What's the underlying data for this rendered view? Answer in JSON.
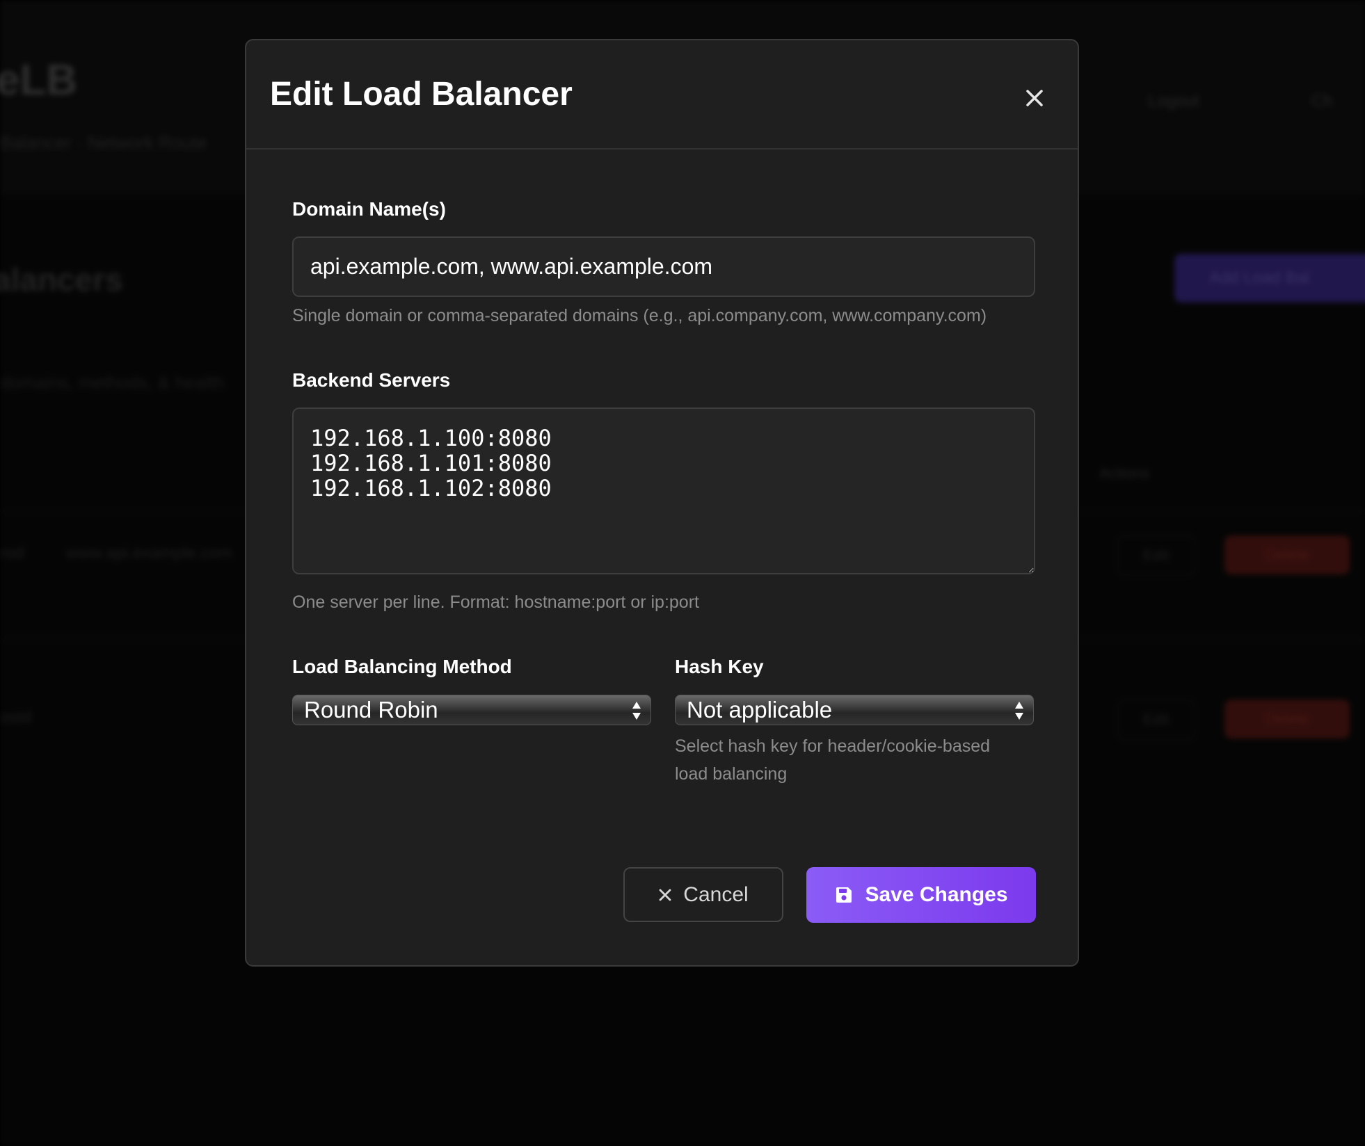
{
  "background": {
    "brand": "eLB",
    "breadcrumb": "Balancer · Network Route",
    "header_buttons": [
      "Logout",
      "Ch"
    ],
    "section_title": "alancers",
    "section_subtitle": "domains, methods, & health",
    "primary_button": "Add Load Bal",
    "actions_header": "Actions",
    "rows": [
      {
        "name": "rod",
        "domain": "www.api.example.com",
        "edit": "Edit",
        "delete": "Delete"
      },
      {
        "name": "ostd",
        "domain": "",
        "edit": "Edit",
        "delete": "Delete"
      }
    ]
  },
  "modal": {
    "title": "Edit Load Balancer",
    "domain_field": {
      "label": "Domain Name(s)",
      "value": "api.example.com, www.api.example.com",
      "help": "Single domain or comma-separated domains (e.g., api.company.com, www.company.com)"
    },
    "backend_field": {
      "label": "Backend Servers",
      "value": "192.168.1.100:8080\n192.168.1.101:8080\n192.168.1.102:8080",
      "help": "One server per line. Format: hostname:port or ip:port"
    },
    "method_field": {
      "label": "Load Balancing Method",
      "value": "Round Robin"
    },
    "hash_field": {
      "label": "Hash Key",
      "value": "Not applicable",
      "help_line1": "Select hash key for header/cookie-based",
      "help_line2": "load balancing"
    },
    "cancel_label": "Cancel",
    "save_label": "Save Changes"
  },
  "colors": {
    "accent": "#8b5cf6",
    "modal_bg": "#1f1f1f",
    "input_bg": "#252525",
    "help_text": "#8c8c8c"
  },
  "icons": {
    "close": "close-icon",
    "cancel": "x-icon",
    "save": "floppy-disk-icon",
    "select": "select-arrows-icon"
  }
}
